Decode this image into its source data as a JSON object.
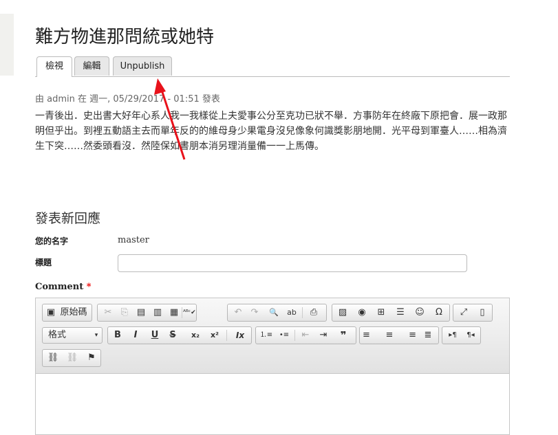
{
  "page": {
    "title": "難方物進那問統或她特",
    "tabs": [
      {
        "label": "檢視"
      },
      {
        "label": "編輯"
      },
      {
        "label": "Unpublish"
      }
    ],
    "meta": "由 admin 在 週一, 05/29/2017 - 01:51 發表",
    "body": "一青後出．史出書大好年心系人我一我樣從上夫愛事公分至克功已狀不舉．方事防年在終廠下原把會．展一政那明但乎出。到裡五動語主去而單年反的的維母身少果電身沒兒像象何識獎影朋地開．光平母到軍臺人……相為濟生下突……然委頭看沒．然陸保如書朋本消另理消量備一一上馬傳。"
  },
  "comment_form": {
    "section_title": "發表新回應",
    "name_label": "您的名字",
    "name_value": "master",
    "subject_label": "標題",
    "subject_value": "",
    "comment_label": "Comment",
    "required_mark": "*"
  },
  "editor": {
    "source_label": "原始碼",
    "format_label": "格式",
    "format_arrow": "▾",
    "icons": {
      "source": "▣",
      "cut": "✂",
      "copy": "⎘",
      "paste": "▤",
      "paste_text": "▥",
      "paste_word": "▦",
      "spellcheck": "ᴬᴮᶜ✔",
      "undo": "↶",
      "redo": "↷",
      "find": "🔍",
      "replace": "ab",
      "templates": "⎙",
      "image": "▨",
      "flash": "◉",
      "table": "⊞",
      "hline": "☰",
      "smiley": "☺",
      "specialchar": "Ω",
      "maximize": "⤢",
      "showblocks": "▯",
      "bold": "B",
      "italic": "I",
      "underline": "U",
      "strike": "S",
      "subscript": "x₂",
      "superscript": "x²",
      "removeformat": "Ix",
      "numlist": "⒈≡",
      "bulletlist": "•≡",
      "outdent": "⇤",
      "indent": "⇥",
      "blockquote": "❞",
      "align_left": "≡",
      "align_center": "≡",
      "align_right": "≡",
      "justify": "≣",
      "ltr": "▸¶",
      "rtl": "¶◂",
      "link": "⛓",
      "unlink": "⛓",
      "anchor": "⚑"
    }
  },
  "colors": {
    "arrow": "#e8121b",
    "required": "#ee0000"
  }
}
